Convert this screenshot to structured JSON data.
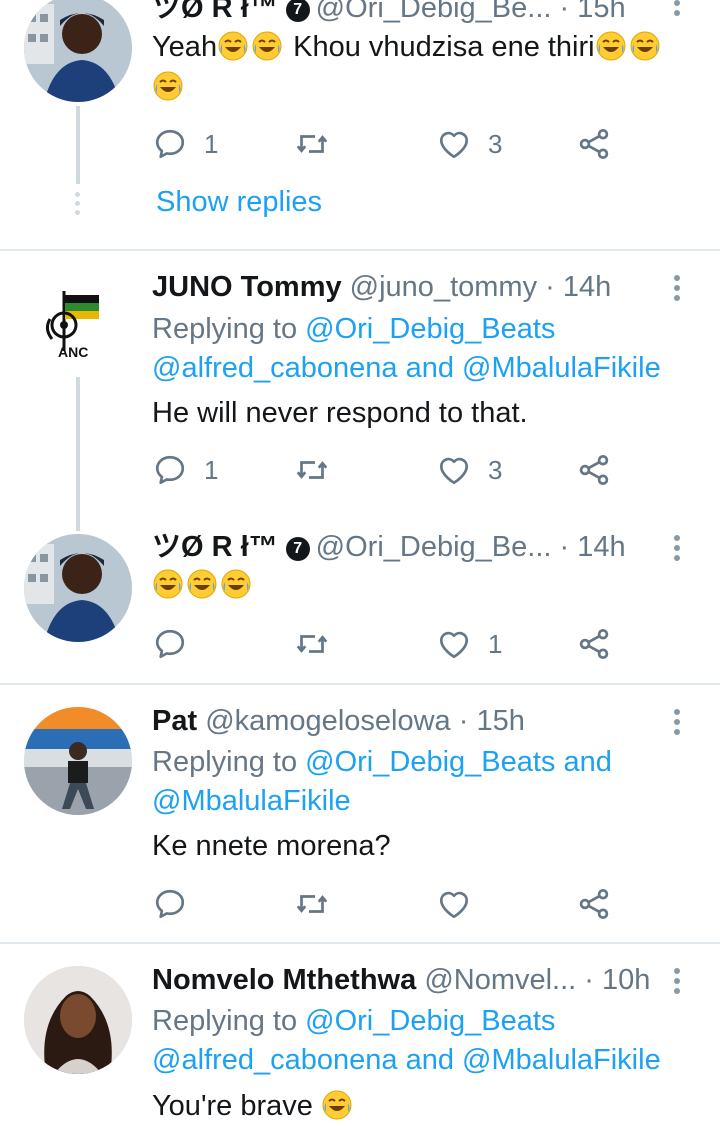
{
  "tweets": [
    {
      "name": "ツØ R ł™",
      "verified_icon": "7",
      "handle": "@Ori_Debig_Be...",
      "time": "15h",
      "body": "Yeah",
      "body2": " Khou vhudzisa ene thiri",
      "replies": "1",
      "likes": "3",
      "show_replies": "Show replies",
      "emoji": "laughing-tears"
    },
    {
      "name": "JUNO Tommy",
      "handle": "@juno_tommy",
      "time": "14h",
      "replying_prefix": "Replying to",
      "mentions_line1": "@Ori_Debig_Beats",
      "mentions_line2a": "@alfred_cabonena",
      "mentions_and": "and",
      "mentions_line2b": "@MbalulaFikile",
      "body": "He will never respond to that.",
      "replies": "1",
      "likes": "3",
      "avatar_text": "ANC"
    },
    {
      "name": "ツØ R ł™",
      "verified_icon": "7",
      "handle": "@Ori_Debig_Be...",
      "time": "14h",
      "likes": "1"
    },
    {
      "name": "Pat",
      "handle": "@kamogeloselowa",
      "time": "15h",
      "replying_prefix": "Replying to",
      "mention1": "@Ori_Debig_Beats",
      "and": "and",
      "mention2": "@MbalulaFikile",
      "body": "Ke nnete morena?"
    },
    {
      "name": "Nomvelo Mthethwa",
      "handle": "@Nomvel...",
      "time": "10h",
      "replying_prefix": "Replying to",
      "mentions_line1": "@Ori_Debig_Beats",
      "mentions_line2a": "@alfred_cabonena",
      "mentions_and": "and",
      "mentions_line2b": "@MbalulaFikile",
      "body": "You're brave"
    }
  ],
  "separator": "·",
  "colors": {
    "accent": "#1da1f2",
    "muted": "#657786",
    "divider": "#e1e8ed",
    "emoji_face": "#ffcc33"
  }
}
